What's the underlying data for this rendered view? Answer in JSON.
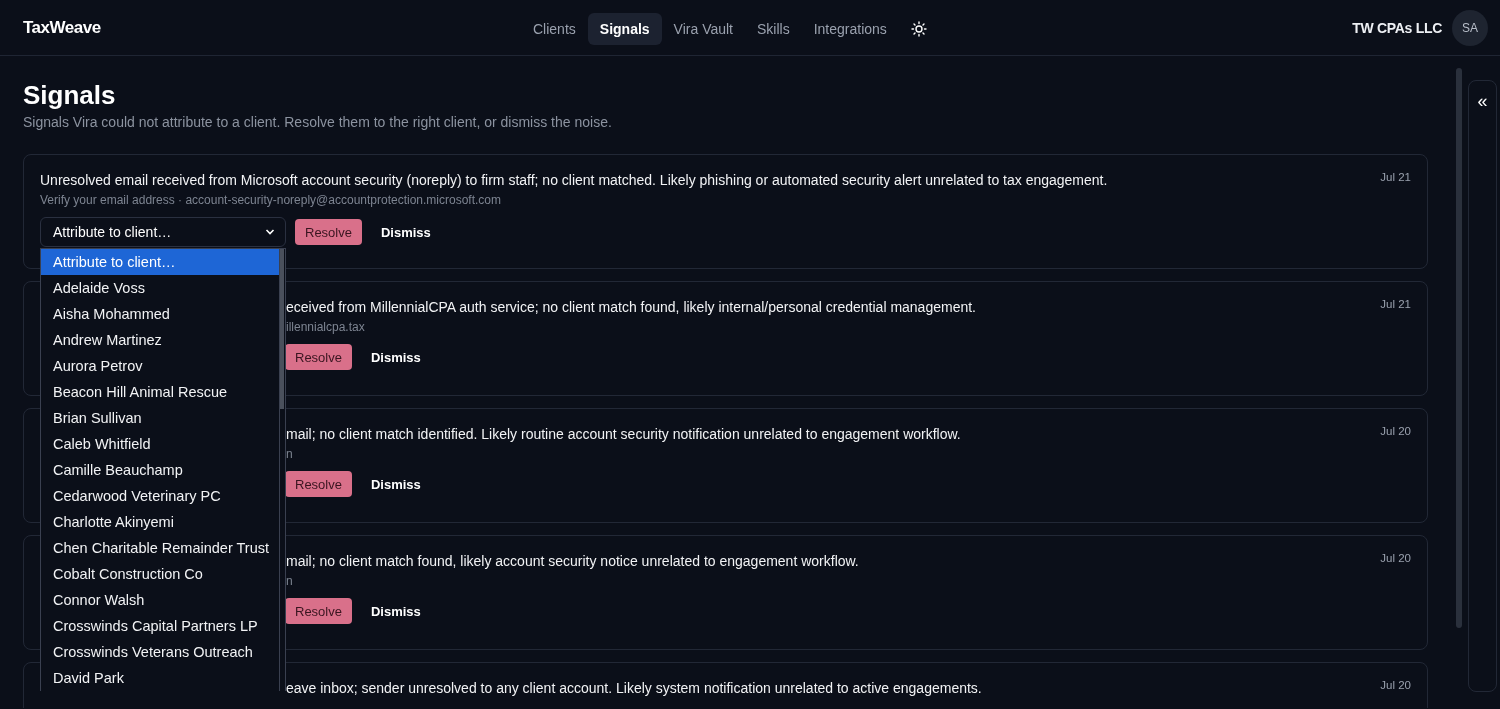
{
  "header": {
    "logo": "TaxWeave",
    "nav": [
      {
        "label": "Clients",
        "selected": false
      },
      {
        "label": "Signals",
        "selected": true
      },
      {
        "label": "Vira Vault",
        "selected": false
      },
      {
        "label": "Skills",
        "selected": false
      },
      {
        "label": "Integrations",
        "selected": false
      }
    ],
    "firm": "TW CPAs LLC",
    "avatar": "SA"
  },
  "page": {
    "title": "Signals",
    "subtitle": "Signals Vira could not attribute to a client. Resolve them to the right client, or dismiss the noise."
  },
  "side_panel": {
    "toggle": "«"
  },
  "signals": [
    {
      "summary": "Unresolved email received from Microsoft account security (noreply) to firm staff; no client matched. Likely phishing or automated security alert unrelated to tax engagement.",
      "detail": "Verify your email address · account-security-noreply@accountprotection.microsoft.com",
      "date": "Jul 21",
      "buttons": [
        "Resolve",
        "Dismiss"
      ],
      "picker": {
        "value": "Attribute to client…",
        "open": true,
        "options": [
          {
            "label": "Attribute to client…",
            "selected": true
          },
          {
            "label": "Adelaide Voss",
            "selected": false
          },
          {
            "label": "Aisha Mohammed",
            "selected": false
          },
          {
            "label": "Andrew Martinez",
            "selected": false
          },
          {
            "label": "Aurora Petrov",
            "selected": false
          },
          {
            "label": "Beacon Hill Animal Rescue",
            "selected": false
          },
          {
            "label": "Brian Sullivan",
            "selected": false
          },
          {
            "label": "Caleb Whitfield",
            "selected": false
          },
          {
            "label": "Camille Beauchamp",
            "selected": false
          },
          {
            "label": "Cedarwood Veterinary PC",
            "selected": false
          },
          {
            "label": "Charlotte Akinyemi",
            "selected": false
          },
          {
            "label": "Chen Charitable Remainder Trust",
            "selected": false
          },
          {
            "label": "Cobalt Construction Co",
            "selected": false
          },
          {
            "label": "Connor Walsh",
            "selected": false
          },
          {
            "label": "Crosswinds Capital Partners LP",
            "selected": false
          },
          {
            "label": "Crosswinds Veterans Outreach",
            "selected": false
          },
          {
            "label": "David Park",
            "selected": false
          }
        ]
      }
    },
    {
      "summary": "eceived from MillennialCPA auth service; no client match found, likely internal/personal credential management.",
      "detail": "illennialcpa.tax",
      "date": "Jul 21",
      "buttons": [
        "Resolve",
        "Dismiss"
      ]
    },
    {
      "summary": "mail; no client match identified. Likely routine account security notification unrelated to engagement workflow.",
      "detail": "n",
      "date": "Jul 20",
      "buttons": [
        "Resolve",
        "Dismiss"
      ]
    },
    {
      "summary": "mail; no client match found, likely account security notice unrelated to engagement workflow.",
      "detail": "n",
      "date": "Jul 20",
      "buttons": [
        "Resolve",
        "Dismiss"
      ]
    },
    {
      "summary": "eave inbox; sender unresolved to any client account. Likely system notification unrelated to active engagements.",
      "date": "Jul 20"
    }
  ]
}
